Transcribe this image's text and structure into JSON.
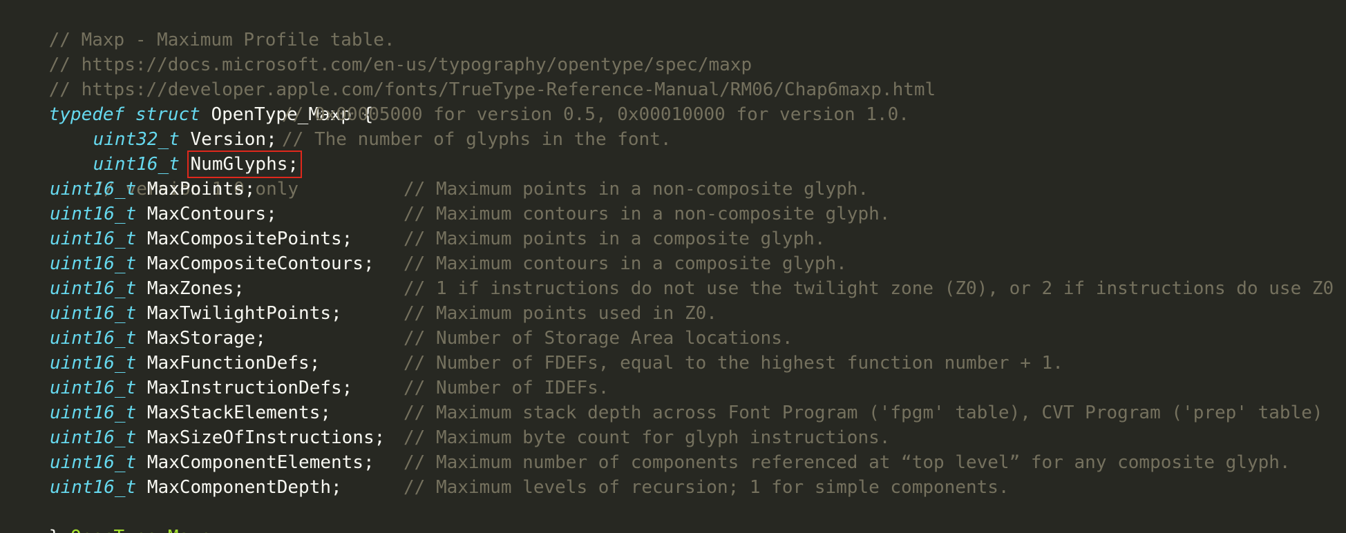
{
  "header_comments": [
    "// Maxp - Maximum Profile table.",
    "// https://docs.microsoft.com/en-us/typography/opentype/spec/maxp",
    "// https://developer.apple.com/fonts/TrueType-Reference-Manual/RM06/Chap6maxp.html"
  ],
  "struct_open": {
    "kw_typedef": "typedef",
    "kw_struct": "struct",
    "name": "OpenType_Maxp",
    "brace": "{"
  },
  "version_field": {
    "type": "uint32_t",
    "name": "Version;",
    "comment": "// 0x00005000 for version 0.5, 0x00010000 for version 1.0."
  },
  "numglyphs_field": {
    "type": "uint16_t",
    "name": "NumGlyphs;",
    "comment": "// The number of glyphs in the font."
  },
  "version_only_comment": "// version 1.0 only",
  "fields": [
    {
      "type": "uint16_t",
      "name": "MaxPoints;",
      "comment": "// Maximum points in a non-composite glyph."
    },
    {
      "type": "uint16_t",
      "name": "MaxContours;",
      "comment": "// Maximum contours in a non-composite glyph."
    },
    {
      "type": "uint16_t",
      "name": "MaxCompositePoints;",
      "comment": "// Maximum points in a composite glyph."
    },
    {
      "type": "uint16_t",
      "name": "MaxCompositeContours;",
      "comment": "// Maximum contours in a composite glyph."
    },
    {
      "type": "uint16_t",
      "name": "MaxZones;",
      "comment": "// 1 if instructions do not use the twilight zone (Z0), or 2 if instructions do use Z0"
    },
    {
      "type": "uint16_t",
      "name": "MaxTwilightPoints;",
      "comment": "// Maximum points used in Z0."
    },
    {
      "type": "uint16_t",
      "name": "MaxStorage;",
      "comment": "// Number of Storage Area locations."
    },
    {
      "type": "uint16_t",
      "name": "MaxFunctionDefs;",
      "comment": "// Number of FDEFs, equal to the highest function number + 1."
    },
    {
      "type": "uint16_t",
      "name": "MaxInstructionDefs;",
      "comment": "// Number of IDEFs."
    },
    {
      "type": "uint16_t",
      "name": "MaxStackElements;",
      "comment": "// Maximum stack depth across Font Program ('fpgm' table), CVT Program ('prep' table)"
    },
    {
      "type": "uint16_t",
      "name": "MaxSizeOfInstructions;",
      "comment": "// Maximum byte count for glyph instructions."
    },
    {
      "type": "uint16_t",
      "name": "MaxComponentElements;",
      "comment": "// Maximum number of components referenced at “top level” for any composite glyph."
    },
    {
      "type": "uint16_t",
      "name": "MaxComponentDepth;",
      "comment": "// Maximum levels of recursion; 1 for simple components."
    }
  ],
  "struct_close": {
    "brace": "}",
    "name": "OpenType_Maxp",
    "semicolon": ";"
  },
  "colors": {
    "background": "#272822",
    "comment": "#75715e",
    "keyword": "#66d9ef",
    "identifier": "#f8f8f2",
    "type_name": "#a6e22e",
    "highlight_box": "#e0281c"
  }
}
